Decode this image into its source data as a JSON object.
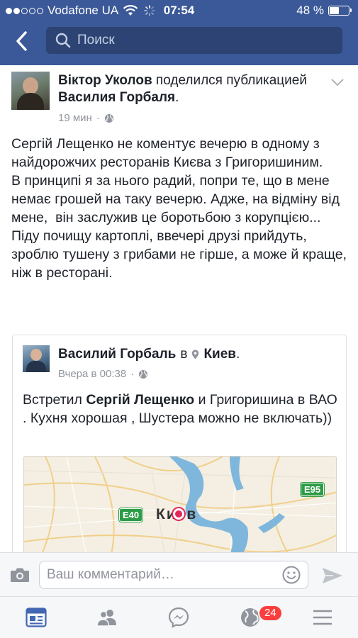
{
  "status_bar": {
    "carrier": "Vodafone UA",
    "time": "07:54",
    "battery": "48 %",
    "battery_level": 0.48
  },
  "nav": {
    "search_placeholder": "Поиск"
  },
  "post": {
    "author": "Віктор Уколов",
    "action": " поделился публикацией ",
    "shared_from": "Василия Горбаля",
    "period": ".",
    "time": "19 мин",
    "privacy_dot": "·",
    "text": "Сергій Лещенко не коментує вечерю в одному з найдорожчих ресторанів Києва з Григоришиним.\nВ принципі я за нього радий, попри те, що в мене немає грошей на таку вечерю. Адже, на відміну від мене,  він заслужив це боротьбою з корупцією...\nПіду почищу картоплі, ввечері друзі прийдуть, зроблю тушену з грибами не гірше, а може й краще, ніж в ресторані."
  },
  "shared_post": {
    "author": "Василий Горбаль",
    "in_word": "в",
    "location": "Киев",
    "period": ".",
    "time": "Вчера в 00:38",
    "privacy_dot": "·",
    "text_prefix": "Встретил ",
    "tagged": "Сергій Лещенко",
    "text_suffix": " и Григоришина в ВАО . Кухня хорошая , Шустера можно не включать))",
    "map": {
      "city_label": "Киев",
      "road_e40": "E40",
      "road_e95": "E95"
    }
  },
  "comment_bar": {
    "placeholder": "Ваш комментарий…"
  },
  "tabbar": {
    "notifications_badge": "24"
  },
  "colors": {
    "brand": "#3b5998",
    "badge": "#fa3e3e",
    "river": "#7fb6dc",
    "pin": "#e2275a"
  }
}
